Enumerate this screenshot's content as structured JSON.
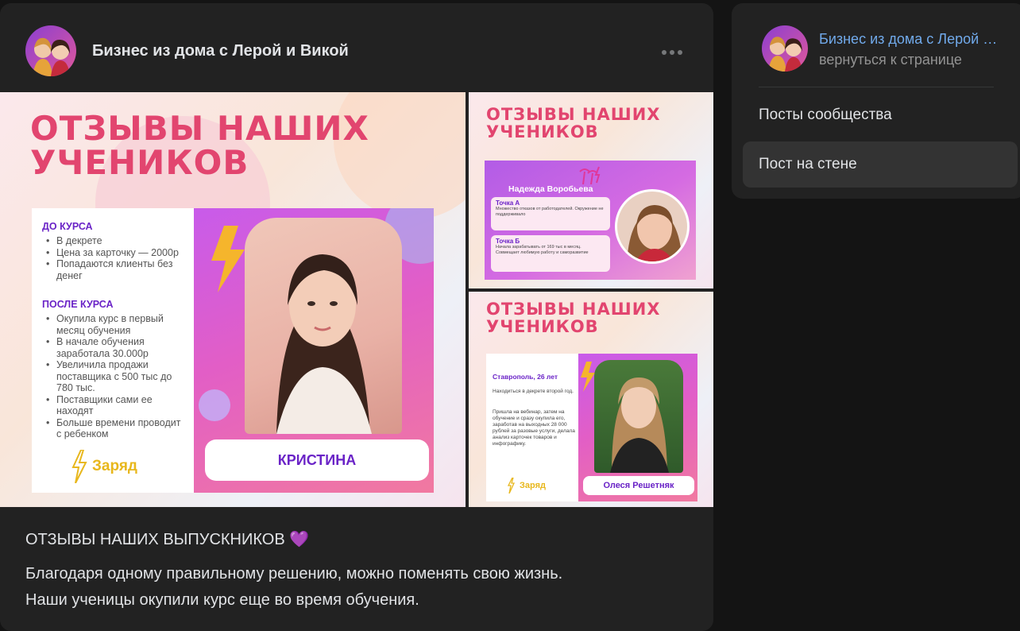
{
  "post": {
    "author": "Бизнес из дома с Лерой и Викой",
    "title": "ОТЗЫВЫ НАШИХ ВЫПУСКНИКОВ 💜",
    "body_line1": "Благодаря одному правильному решению, можно поменять свою жизнь.",
    "body_line2": "Наши ученицы окупили курс еще во время обучения."
  },
  "images": {
    "main": {
      "headline": "ОТЗЫВЫ НАШИХ\nУЧЕНИКОВ",
      "before_title": "ДО КУРСА",
      "before_items": [
        "В декрете",
        "Цена за карточку — 2000р",
        "Попадаются клиенты без денег"
      ],
      "after_title": "ПОСЛЕ КУРСА",
      "after_items": [
        "Окупила курс в первый месяц обучения",
        "В начале обучения заработала 30.000р",
        "Увеличила продажи поставщика с 500 тыс до 780 тыс.",
        "Поставщики сами ее находят",
        "Больше времени проводит с ребенком"
      ],
      "brand": "Заряд",
      "name": "КРИСТИНА"
    },
    "top_right": {
      "headline": "ОТЗЫВЫ НАШИХ\nУЧЕНИКОВ",
      "person": "Надежда Воробьева",
      "point_a": "Точка А",
      "point_a_text": "Множество отказов от работодателей. Окружение не поддерживало",
      "point_b": "Точка Б",
      "point_b_text": "Начала зарабатывать от 169 тыс в месяц. Совмещает любимую работу и саморазвитие"
    },
    "bottom_right": {
      "headline": "ОТЗЫВЫ НАШИХ\nУЧЕНИКОВ",
      "city": "Ставрополь, 26 лет",
      "text1": "Находиться в декрете второй год.",
      "text2": "Пришла на вебинар, затем на обучение и сразу окупила его, заработав на выходных 28 000 рублей за разовые услуги, делала анализ карточек товаров и инфографику.",
      "brand": "Заряд",
      "name": "Олеся Решетняк"
    }
  },
  "sidebar": {
    "name": "Бизнес из дома с Лерой и Викой",
    "back_link": "вернуться к странице",
    "menu": [
      {
        "label": "Посты сообщества",
        "active": false
      },
      {
        "label": "Пост на стене",
        "active": true
      }
    ]
  },
  "colors": {
    "headline": "#e2456f",
    "accent_purple": "#6a23c7",
    "link": "#71aaeb",
    "brand_yellow": "#e8b71c"
  }
}
